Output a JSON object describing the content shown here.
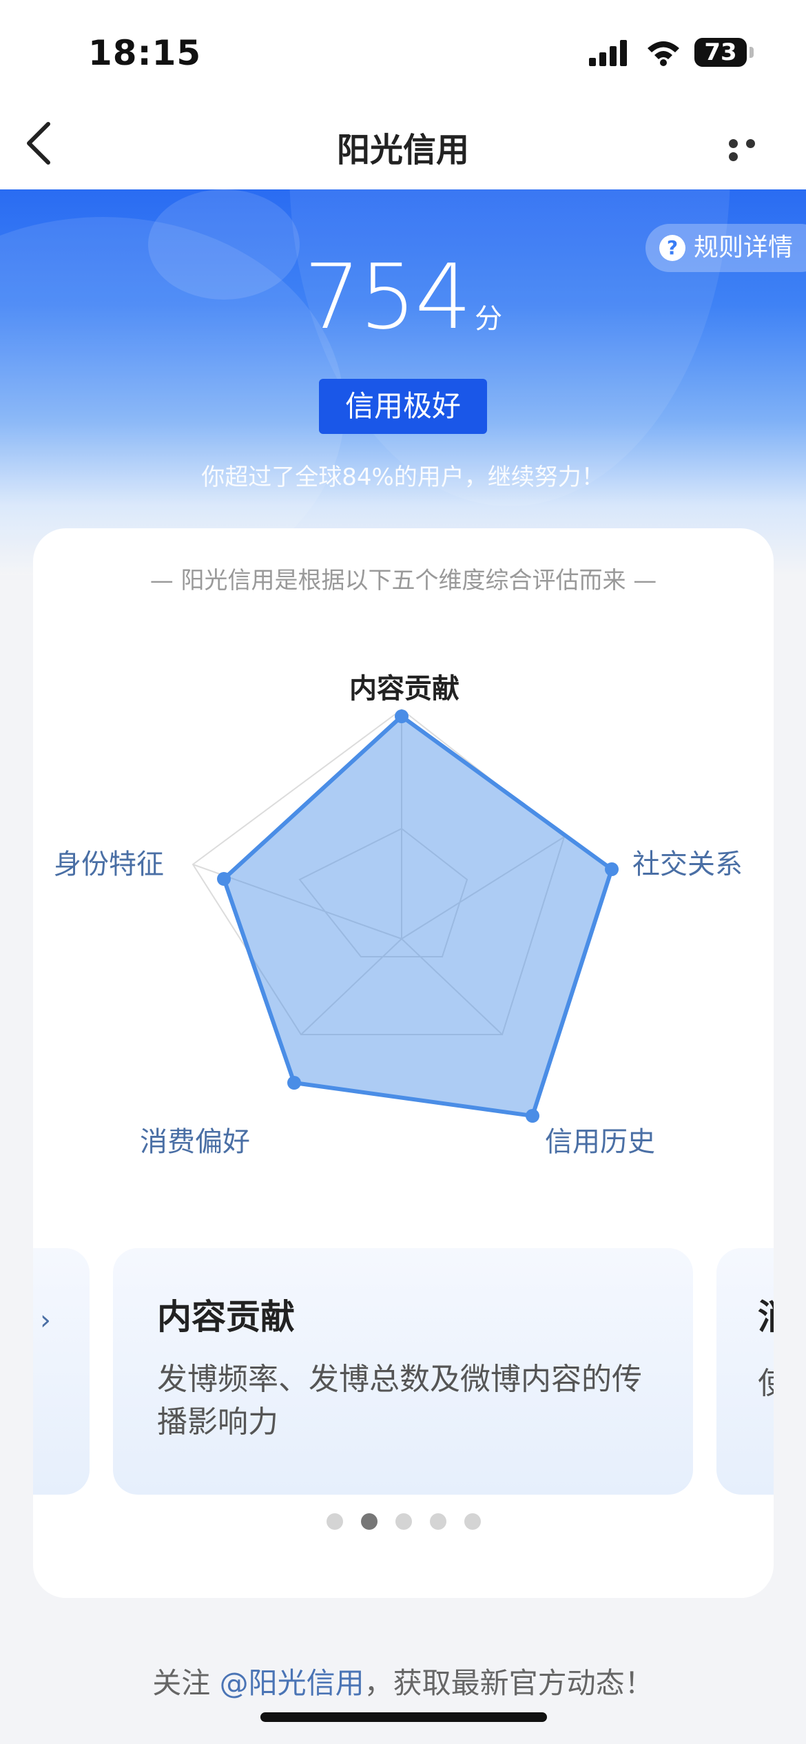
{
  "status_bar": {
    "time": "18:15",
    "battery": "73"
  },
  "nav": {
    "title": "阳光信用"
  },
  "header": {
    "rules_label": "规则详情",
    "score": "754",
    "score_unit": "分",
    "level": "信用极好",
    "beat_text": "你超过了全球84%的用户，继续努力！"
  },
  "card": {
    "subtitle": "— 阳光信用是根据以下五个维度综合评估而来 —",
    "radar": {
      "dimensions": [
        "内容贡献",
        "社交关系",
        "信用历史",
        "消费偏好",
        "身份特征"
      ],
      "active": "内容贡献"
    },
    "carousel": {
      "current": {
        "title": "内容贡献",
        "desc": "发博频率、发博总数及微博内容的传播影响力"
      },
      "next_title_partial": "消",
      "next_desc_partial": "使",
      "prev_arrow": "›",
      "prev_dot": "·",
      "active_index": 1,
      "total": 5
    }
  },
  "footer": {
    "prefix": "关注 ",
    "link": "@阳光信用",
    "suffix": "，获取最新官方动态！"
  },
  "colors": {
    "primary": "#2a6cf2",
    "radar_fill": "#4a8de6",
    "badge": "#1a57e8"
  }
}
